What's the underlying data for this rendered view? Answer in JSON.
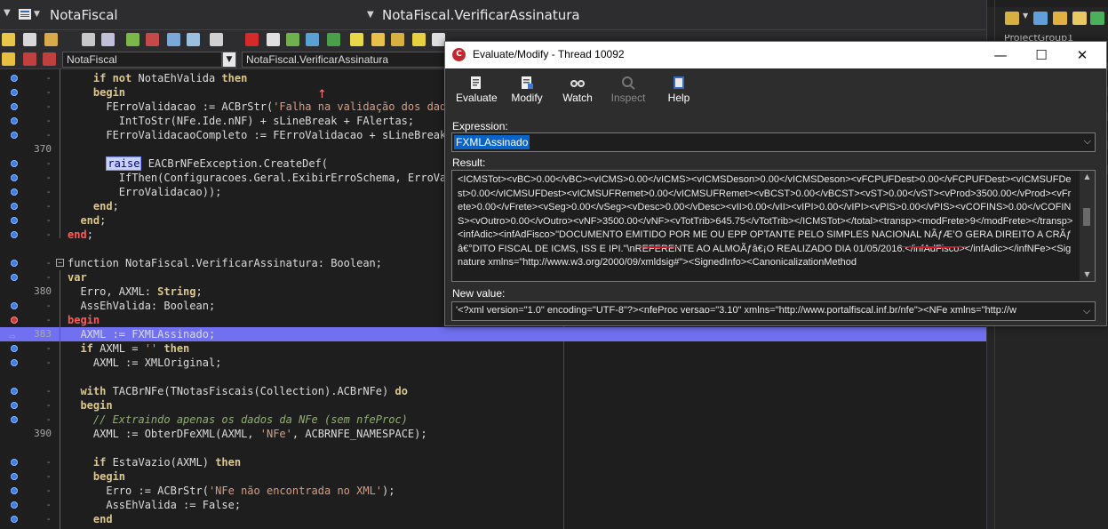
{
  "ide": {
    "title": "NotaFiscal",
    "title_right": "NotaFiscal.VerificarAssinatura",
    "unit_combo": "NotaFiscal",
    "method_combo": "NotaFiscal.VerificarAssinatura",
    "project_group": "ProjectGroup1"
  },
  "editor": {
    "lines": [
      {
        "num": "-",
        "segs": [
          [
            "    ",
            ""
          ],
          [
            "if not ",
            "kw"
          ],
          [
            "NotaEhValida",
            ""
          ],
          [
            " then",
            "kw"
          ]
        ],
        "bp": "blue"
      },
      {
        "num": "-",
        "segs": [
          [
            "    ",
            ""
          ],
          [
            "begin",
            "kw"
          ]
        ],
        "bp": "blue"
      },
      {
        "num": "-",
        "segs": [
          [
            "      FErroValidacao := ACBrStr(",
            ""
          ],
          [
            "'Falha na validação dos dados",
            "str"
          ]
        ],
        "bp": "blue"
      },
      {
        "num": "-",
        "segs": [
          [
            "        IntToStr(NFe.Ide.nNF) + sLineBreak + FAlertas;",
            ""
          ]
        ],
        "bp": "blue"
      },
      {
        "num": "-",
        "segs": [
          [
            "      FErroValidacaoCompleto := FErroValidacao + sLineBreak + ",
            ""
          ]
        ],
        "bp": "blue"
      },
      {
        "num": "370",
        "segs": [
          [
            "",
            ""
          ]
        ],
        "bp": ""
      },
      {
        "num": "-",
        "segs": [
          [
            "      ",
            ""
          ],
          [
            "raise",
            "hl"
          ],
          [
            " EACBrNFeException.CreateDef(",
            ""
          ]
        ],
        "bp": "blue"
      },
      {
        "num": "-",
        "segs": [
          [
            "        IfThen(Configuracoes.Geral.ExibirErroSchema, ErroVali",
            ""
          ]
        ],
        "bp": "blue"
      },
      {
        "num": "-",
        "segs": [
          [
            "        ErroValidacao));",
            ""
          ]
        ],
        "bp": "blue"
      },
      {
        "num": "-",
        "segs": [
          [
            "    ",
            ""
          ],
          [
            "end",
            "kw"
          ],
          [
            ";",
            ""
          ]
        ],
        "bp": "blue"
      },
      {
        "num": "-",
        "segs": [
          [
            "  ",
            ""
          ],
          [
            "end",
            "kw"
          ],
          [
            ";",
            ""
          ]
        ],
        "bp": "blue"
      },
      {
        "num": "-",
        "segs": [
          [
            "",
            ""
          ],
          [
            "end",
            "red-kw"
          ],
          [
            ";",
            ""
          ]
        ],
        "bp": "blue"
      },
      {
        "num": "",
        "segs": [
          [
            "",
            ""
          ]
        ],
        "bp": ""
      },
      {
        "num": "-",
        "segs": [
          [
            "function NotaFiscal.VerificarAssinatura: Boolean;",
            ""
          ]
        ],
        "bp": "blue"
      },
      {
        "num": "-",
        "segs": [
          [
            "var",
            "kw"
          ]
        ],
        "bp": "blue"
      },
      {
        "num": "380",
        "segs": [
          [
            "  Erro, AXML: ",
            ""
          ],
          [
            "String",
            "kw"
          ],
          [
            ";",
            ""
          ]
        ],
        "bp": ""
      },
      {
        "num": "-",
        "segs": [
          [
            "  AssEhValida: Boolean;",
            ""
          ]
        ],
        "bp": "blue"
      },
      {
        "num": "-",
        "segs": [
          [
            "begin",
            "red-kw"
          ]
        ],
        "bp": "red"
      },
      {
        "num": "383",
        "segs": [
          [
            "  AXML := FXMLAssinado;",
            ""
          ]
        ],
        "bp": "arrow",
        "current": true
      },
      {
        "num": "-",
        "segs": [
          [
            "  ",
            ""
          ],
          [
            "if",
            "kw"
          ],
          [
            " AXML = ",
            ""
          ],
          [
            "''",
            "str"
          ],
          [
            " then",
            "kw"
          ]
        ],
        "bp": "blue"
      },
      {
        "num": "-",
        "segs": [
          [
            "    AXML := XMLOriginal;",
            ""
          ]
        ],
        "bp": "blue"
      },
      {
        "num": "",
        "segs": [
          [
            "",
            ""
          ]
        ],
        "bp": ""
      },
      {
        "num": "-",
        "segs": [
          [
            "  ",
            ""
          ],
          [
            "with",
            "kw"
          ],
          [
            " TACBrNFe(TNotasFiscais(Collection).ACBrNFe) ",
            ""
          ],
          [
            "do",
            "kw"
          ]
        ],
        "bp": "blue"
      },
      {
        "num": "-",
        "segs": [
          [
            "  ",
            ""
          ],
          [
            "begin",
            "kw"
          ]
        ],
        "bp": "blue"
      },
      {
        "num": "-",
        "segs": [
          [
            "    // Extraindo apenas os dados da NFe (sem nfeProc)",
            "cm"
          ]
        ],
        "bp": "blue"
      },
      {
        "num": "390",
        "segs": [
          [
            "    AXML := ObterDFeXML(AXML, ",
            ""
          ],
          [
            "'NFe'",
            "str"
          ],
          [
            ", ACBRNFE_NAMESPACE);",
            ""
          ]
        ],
        "bp": ""
      },
      {
        "num": "",
        "segs": [
          [
            "",
            ""
          ]
        ],
        "bp": ""
      },
      {
        "num": "-",
        "segs": [
          [
            "    ",
            ""
          ],
          [
            "if",
            "kw"
          ],
          [
            " EstaVazio(AXML) ",
            ""
          ],
          [
            "then",
            "kw"
          ]
        ],
        "bp": "blue"
      },
      {
        "num": "-",
        "segs": [
          [
            "    ",
            ""
          ],
          [
            "begin",
            "kw"
          ]
        ],
        "bp": "blue"
      },
      {
        "num": "-",
        "segs": [
          [
            "      Erro := ACBrStr(",
            ""
          ],
          [
            "'NFe não encontrada no XML'",
            "str"
          ],
          [
            ");",
            ""
          ]
        ],
        "bp": "blue"
      },
      {
        "num": "-",
        "segs": [
          [
            "      AssEhValida := False;",
            ""
          ]
        ],
        "bp": "blue"
      },
      {
        "num": "-",
        "segs": [
          [
            "    ",
            ""
          ],
          [
            "end",
            "kw"
          ]
        ],
        "bp": "blue"
      }
    ]
  },
  "dialog": {
    "title": "Evaluate/Modify - Thread 10092",
    "tools": [
      {
        "label": "Evaluate",
        "icon": "evaluate-icon",
        "enabled": true
      },
      {
        "label": "Modify",
        "icon": "modify-icon",
        "enabled": true
      },
      {
        "label": "Watch",
        "icon": "watch-icon",
        "enabled": true
      },
      {
        "label": "Inspect",
        "icon": "inspect-icon",
        "enabled": false
      },
      {
        "label": "Help",
        "icon": "help-icon",
        "enabled": true
      }
    ],
    "expression_label": "Expression:",
    "expression_value": "FXMLAssinado",
    "result_label": "Result:",
    "result_text": "<ICMSTot><vBC>0.00</vBC><vICMS>0.00</vICMS><vICMSDeson>0.00</vICMSDeson><vFCPUFDest>0.00</vFCPUFDest><vICMSUFDest>0.00</vICMSUFDest><vICMSUFRemet>0.00</vICMSUFRemet><vBCST>0.00</vBCST><vST>0.00</vST><vProd>3500.00</vProd><vFrete>0.00</vFrete><vSeg>0.00</vSeg><vDesc>0.00</vDesc><vII>0.00</vII><vIPI>0.00</vIPI><vPIS>0.00</vPIS><vCOFINS>0.00</vCOFINS><vOutro>0.00</vOutro><vNF>3500.00</vNF><vTotTrib>645.75</vTotTrib></ICMSTot></total><transp><modFrete>9</modFrete></transp><infAdic><infAdFisco>\"DOCUMENTO EMITIDO POR ME OU EPP OPTANTE PELO SIMPLES NACIONAL NÃƒÆ’O GERA DIREITO A CRÃƒâ€°DITO FISCAL DE ICMS, ISS E IPI.\"\\nREFERENTE AO ALMOÃƒâ€¡O REALIZADO DIA 01/05/2016.</infAdFisco></infAdic></infNFe><Signature xmlns=\"http://www.w3.org/2000/09/xmldsig#\"><SignedInfo><CanonicalizationMethod",
    "newvalue_label": "New value:",
    "newvalue_text": "'<?xml version=\"1.0\" encoding=\"UTF-8\"?><nfeProc versao=\"3.10\" xmlns=\"http://www.portalfiscal.inf.br/nfe\"><NFe xmlns=\"http://w"
  }
}
